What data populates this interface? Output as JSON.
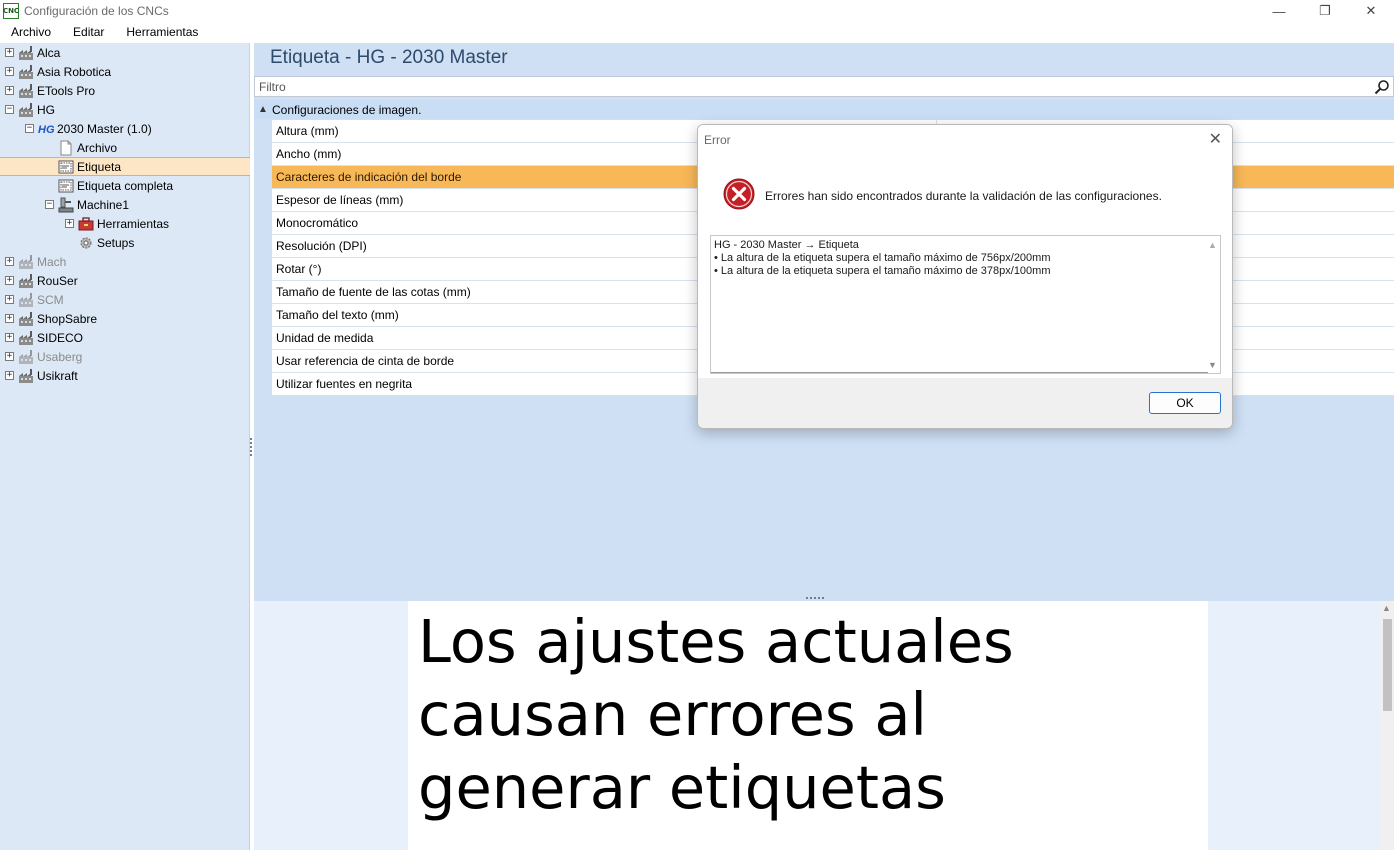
{
  "window": {
    "title": "Configuración de los CNCs",
    "icon_text": "CNC",
    "minimize": "—",
    "restore": "❐",
    "close": "✕"
  },
  "menu": [
    "Archivo",
    "Editar",
    "Herramientas"
  ],
  "tree": [
    {
      "label": "Alca",
      "expander": "+",
      "icon": "factory-icon",
      "disabled": false
    },
    {
      "label": "Asia Robotica",
      "expander": "+",
      "icon": "factory-icon",
      "disabled": false
    },
    {
      "label": "ETools Pro",
      "expander": "+",
      "icon": "factory-icon",
      "disabled": false
    },
    {
      "label": "HG",
      "expander": "−",
      "icon": "factory-icon",
      "disabled": false
    },
    {
      "label": "2030 Master (1.0)",
      "expander": "−",
      "icon": "hg-logo-icon",
      "disabled": false
    },
    {
      "label": "Archivo",
      "expander": "",
      "icon": "document-icon",
      "disabled": false
    },
    {
      "label": "Etiqueta",
      "expander": "",
      "icon": "label-icon",
      "disabled": false,
      "selected": true
    },
    {
      "label": "Etiqueta completa",
      "expander": "",
      "icon": "label-icon",
      "disabled": false
    },
    {
      "label": "Machine1",
      "expander": "−",
      "icon": "machine-icon",
      "disabled": false
    },
    {
      "label": "Herramientas",
      "expander": "+",
      "icon": "toolbox-icon",
      "disabled": false
    },
    {
      "label": "Setups",
      "expander": "",
      "icon": "gear-icon",
      "disabled": false
    },
    {
      "label": "Mach",
      "expander": "+",
      "icon": "factory-icon",
      "disabled": true
    },
    {
      "label": "RouSer",
      "expander": "+",
      "icon": "factory-icon",
      "disabled": false
    },
    {
      "label": "SCM",
      "expander": "+",
      "icon": "factory-icon",
      "disabled": true
    },
    {
      "label": "ShopSabre",
      "expander": "+",
      "icon": "factory-icon",
      "disabled": false
    },
    {
      "label": "SIDECO",
      "expander": "+",
      "icon": "factory-icon",
      "disabled": false
    },
    {
      "label": "Usaberg",
      "expander": "+",
      "icon": "factory-icon",
      "disabled": true
    },
    {
      "label": "Usikraft",
      "expander": "+",
      "icon": "factory-icon",
      "disabled": false
    }
  ],
  "main": {
    "header_title": "Etiqueta - HG - 2030 Master",
    "filter_placeholder": "Filtro",
    "group_label": "Configuraciones de imagen.",
    "properties": [
      "Altura (mm)",
      "Ancho (mm)",
      "Caracteres de indicación del borde",
      "Espesor de líneas (mm)",
      "Monocromático",
      "Resolución (DPI)",
      "Rotar (°)",
      "Tamaño de fuente de las cotas (mm)",
      "Tamaño del texto (mm)",
      "Unidad de medida",
      "Usar referencia de cinta de borde",
      "Utilizar fuentes en negrita"
    ],
    "highlighted_property": "Caracteres de indicación del borde"
  },
  "preview": {
    "line1": "Los ajustes actuales",
    "line2": "causan errores al",
    "line3": "generar etiquetas"
  },
  "dialog": {
    "title": "Error",
    "message": "Errores han sido encontrados durante la validación de las configuraciones.",
    "details": [
      "HG - 2030 Master → Etiqueta",
      "• La altura de la etiqueta supera el tamaño máximo de 756px/200mm",
      "• La altura de la etiqueta supera el tamaño máximo de 378px/100mm"
    ],
    "ok_label": "OK"
  },
  "colors": {
    "tree_bg": "#dce8f5",
    "selection": "#fde6c5",
    "highlight_row": "#f8b858",
    "error_red": "#d9262b"
  }
}
